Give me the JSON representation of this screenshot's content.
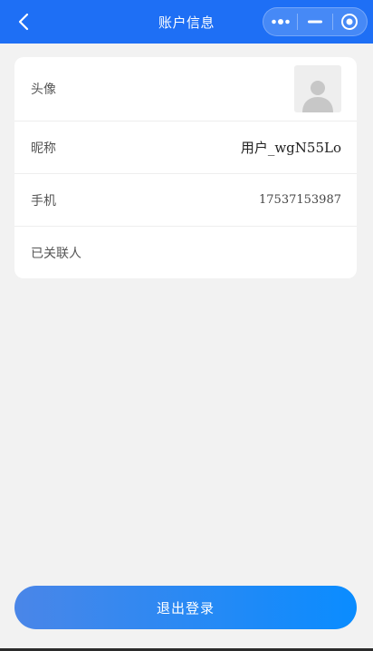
{
  "navbar": {
    "title": "账户信息",
    "back_icon": "chevron-left-icon",
    "capsule": {
      "more_icon": "more-dots-icon",
      "minimize_icon": "minimize-icon",
      "close_icon": "target-close-icon"
    }
  },
  "profile": {
    "avatar": {
      "label": "头像",
      "icon": "avatar-placeholder-icon"
    },
    "nickname": {
      "label": "昵称",
      "value": "用户_wgN55Lo"
    },
    "phone": {
      "label": "手机",
      "value": "17537153987"
    },
    "contacts": {
      "label": "已关联人"
    }
  },
  "actions": {
    "logout_label": "退出登录"
  },
  "colors": {
    "navbar_bg": "#1e6ff5",
    "page_bg": "#f2f2f2",
    "button_gradient_start": "#4a86e8",
    "button_gradient_end": "#0a8cff"
  }
}
